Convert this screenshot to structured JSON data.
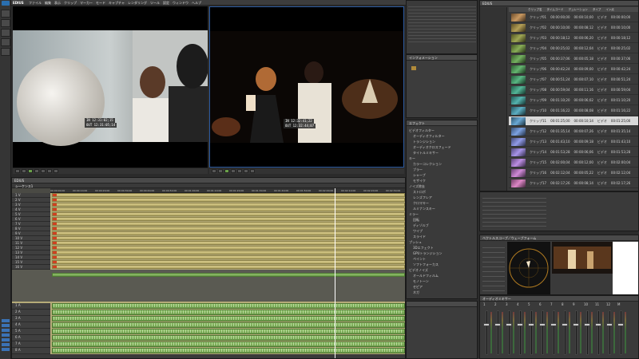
{
  "app": {
    "title": "EDIUS",
    "menu": [
      "ファイル",
      "編集",
      "表示",
      "クリップ",
      "マーカー",
      "モード",
      "キャプチャ",
      "レンダリング",
      "ツール",
      "設定",
      "ウィンドウ",
      "ヘルプ"
    ]
  },
  "player": {
    "timecode_in": "IN 12:31:02;15",
    "timecode_out": "OUT 12:31:05;14"
  },
  "recorder": {
    "timecode_in": "IN 12:32:41;22",
    "timecode_out": "OUT 12:32:44;07"
  },
  "timeline": {
    "title": "EDIUS",
    "sequence_tab": "シーケンス1",
    "ruler": [
      "00:00:00;00",
      "00:00:10;00",
      "00:00:20;00",
      "00:00:30;00",
      "00:00:40;00",
      "00:00:50;00",
      "00:01:00;00",
      "00:01:10;00",
      "00:01:20;00",
      "00:01:30;00",
      "00:01:40;00",
      "00:01:50;00",
      "00:02:00;00",
      "00:02:10;00",
      "00:02:20;00",
      "00:02:30;00"
    ],
    "video_tracks": [
      "1 V",
      "2 V",
      "3 V",
      "4 V",
      "5 V",
      "6 V",
      "7 V",
      "8 V",
      "9 V",
      "10 V",
      "11 V",
      "12 V",
      "13 V",
      "14 V",
      "15 V",
      "16 V"
    ],
    "audio_tracks": [
      "1 A",
      "2 A",
      "3 A",
      "4 A",
      "5 A",
      "6 A",
      "7 A",
      "8 A"
    ]
  },
  "bin": {
    "title": "EDIUS",
    "columns": [
      "クリップ名",
      "タイムコード",
      "デュレーション",
      "タイプ",
      "イン点"
    ],
    "rows": [
      {
        "name": "クリップ01",
        "tc": "00:00:00;00",
        "dur": "00:00:10;00",
        "type": "ビデオ",
        "in": "00:00:00;00"
      },
      {
        "name": "クリップ02",
        "tc": "00:00:10;00",
        "dur": "00:00:08;12",
        "type": "ビデオ",
        "in": "00:00:10;00"
      },
      {
        "name": "クリップ03",
        "tc": "00:00:18;12",
        "dur": "00:00:06;20",
        "type": "ビデオ",
        "in": "00:00:18;12"
      },
      {
        "name": "クリップ04",
        "tc": "00:00:25;02",
        "dur": "00:00:12;04",
        "type": "ビデオ",
        "in": "00:00:25;02"
      },
      {
        "name": "クリップ05",
        "tc": "00:00:37;06",
        "dur": "00:00:05;18",
        "type": "ビデオ",
        "in": "00:00:37;06"
      },
      {
        "name": "クリップ06",
        "tc": "00:00:42;24",
        "dur": "00:00:09;00",
        "type": "ビデオ",
        "in": "00:00:42;24"
      },
      {
        "name": "クリップ07",
        "tc": "00:00:51;24",
        "dur": "00:00:07;10",
        "type": "ビデオ",
        "in": "00:00:51;24"
      },
      {
        "name": "クリップ08",
        "tc": "00:00:59;04",
        "dur": "00:00:11;16",
        "type": "ビデオ",
        "in": "00:00:59;04"
      },
      {
        "name": "クリップ09",
        "tc": "00:01:10;20",
        "dur": "00:00:06;02",
        "type": "ビデオ",
        "in": "00:01:10;20"
      },
      {
        "name": "クリップ10",
        "tc": "00:01:16;22",
        "dur": "00:00:08;08",
        "type": "ビデオ",
        "in": "00:01:16;22"
      },
      {
        "name": "クリップ11",
        "tc": "00:01:25;00",
        "dur": "00:00:10;14",
        "type": "ビデオ",
        "in": "00:01:25;00"
      },
      {
        "name": "クリップ12",
        "tc": "00:01:35;14",
        "dur": "00:00:07;26",
        "type": "ビデオ",
        "in": "00:01:35;14"
      },
      {
        "name": "クリップ13",
        "tc": "00:01:43;10",
        "dur": "00:00:09;18",
        "type": "ビデオ",
        "in": "00:01:43;10"
      },
      {
        "name": "クリップ14",
        "tc": "00:01:53;28",
        "dur": "00:00:06;06",
        "type": "ビデオ",
        "in": "00:01:53;28"
      },
      {
        "name": "クリップ15",
        "tc": "00:02:00;04",
        "dur": "00:00:12;00",
        "type": "ビデオ",
        "in": "00:02:00;04"
      },
      {
        "name": "クリップ16",
        "tc": "00:02:12;04",
        "dur": "00:00:05;22",
        "type": "ビデオ",
        "in": "00:02:12;04"
      },
      {
        "name": "クリップ17",
        "tc": "00:02:17;26",
        "dur": "00:00:08;14",
        "type": "ビデオ",
        "in": "00:02:17;26"
      }
    ]
  },
  "effects": {
    "title": "エフェクト",
    "items": [
      "ビデオフィルター",
      "オーディオフィルター",
      "トランジション",
      "オーディオクロスフェード",
      "タイトルミキサー",
      "キー",
      "カラーコレクション",
      "ブラー",
      "シャープ",
      "モザイク",
      "ノイズ除去",
      "ストロボ",
      "レンズフレア",
      "クロマキー",
      "ルミナンスキー",
      "ミラー",
      "回転",
      "ディゾルブ",
      "ワイプ",
      "スライド",
      "プッシュ",
      "3Dエフェクト",
      "GPUトランジション",
      "ペイント",
      "ソフトフォーカス",
      "ビデオノイズ",
      "オールドフィルム",
      "モノトーン",
      "セピア",
      "ネガ"
    ]
  },
  "vectorscope": {
    "title": "ベクトルスコープ／ウェーブフォーム"
  },
  "mixer": {
    "title": "オーディオミキサー",
    "channels": [
      "1",
      "2",
      "3",
      "4",
      "5",
      "6",
      "7",
      "8",
      "9",
      "10",
      "11",
      "12",
      "M"
    ]
  },
  "info": {
    "title": "インフォメーション"
  }
}
